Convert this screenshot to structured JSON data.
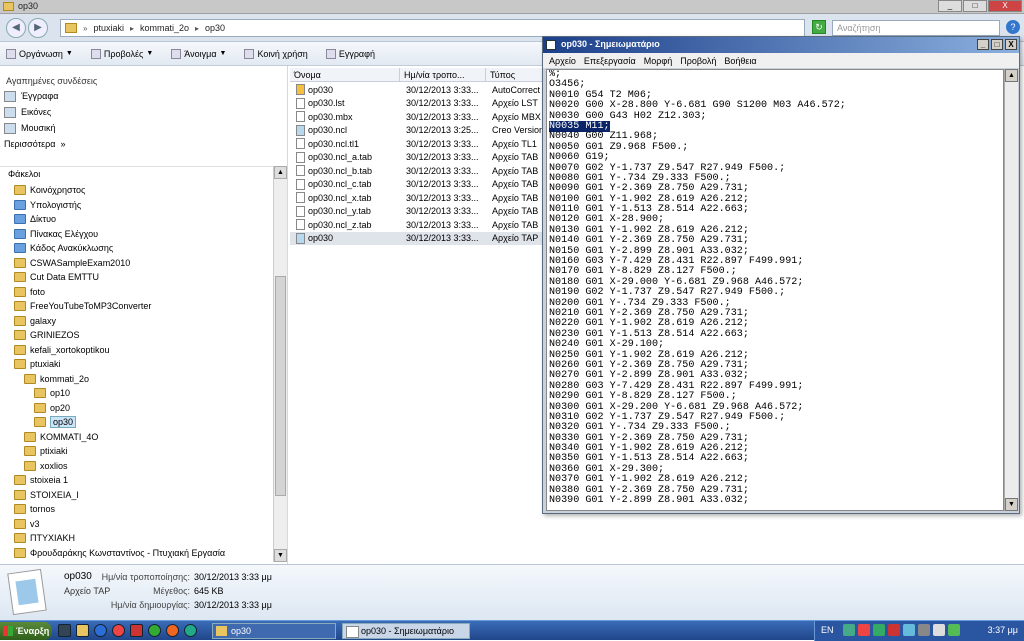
{
  "window": {
    "title": "op30",
    "min_label": "_",
    "max_label": "□",
    "close_label": "X"
  },
  "address": {
    "breadcrumbs": [
      "ptuxiaki",
      "kommati_2o",
      "op30"
    ],
    "search_placeholder": "Αναζήτηση"
  },
  "toolbar": {
    "items": [
      "Οργάνωση",
      "Προβολές",
      "Άνοιγμα",
      "Κοινή χρήση",
      "Εγγραφή"
    ]
  },
  "sidebar": {
    "favorites_header": "Αγαπημένες συνδέσεις",
    "favorites": [
      "Έγγραφα",
      "Εικόνες",
      "Μουσική",
      "Περισσότερα"
    ],
    "folders_header": "Φάκελοι",
    "folders": [
      {
        "label": "Κοινόχρηστος",
        "level": 1,
        "special": false
      },
      {
        "label": "Υπολογιστής",
        "level": 1,
        "special": true
      },
      {
        "label": "Δίκτυο",
        "level": 1,
        "special": true
      },
      {
        "label": "Πίνακας Ελέγχου",
        "level": 1,
        "special": true
      },
      {
        "label": "Κάδος Ανακύκλωσης",
        "level": 1,
        "special": true
      },
      {
        "label": "CSWASampleExam2010",
        "level": 1,
        "special": false
      },
      {
        "label": "Cut Data EMTTU",
        "level": 1,
        "special": false
      },
      {
        "label": "foto",
        "level": 1,
        "special": false
      },
      {
        "label": "FreeYouTubeToMP3Converter",
        "level": 1,
        "special": false
      },
      {
        "label": "galaxy",
        "level": 1,
        "special": false
      },
      {
        "label": "GRINIEZOS",
        "level": 1,
        "special": false
      },
      {
        "label": "kefali_xortokoptikou",
        "level": 1,
        "special": false
      },
      {
        "label": "ptuxiaki",
        "level": 1,
        "special": false
      },
      {
        "label": "kommati_2o",
        "level": 2,
        "special": false
      },
      {
        "label": "op10",
        "level": 3,
        "special": false
      },
      {
        "label": "op20",
        "level": 3,
        "special": false
      },
      {
        "label": "op30",
        "level": 3,
        "special": false,
        "selected": true
      },
      {
        "label": "KOMMATI_4O",
        "level": 2,
        "special": false
      },
      {
        "label": "ptixiaki",
        "level": 2,
        "special": false
      },
      {
        "label": "xoxlios",
        "level": 2,
        "special": false
      },
      {
        "label": "stoixeia 1",
        "level": 1,
        "special": false
      },
      {
        "label": "STOIXEIA_I",
        "level": 1,
        "special": false
      },
      {
        "label": "tornos",
        "level": 1,
        "special": false
      },
      {
        "label": "v3",
        "level": 1,
        "special": false
      },
      {
        "label": "ΠΤΥΧΙΑΚΗ",
        "level": 1,
        "special": false
      },
      {
        "label": "Φρουδαράκης Κωνσταντίνος - Πτυχιακή Εργασία",
        "level": 1,
        "special": false
      }
    ]
  },
  "filelist": {
    "headers": [
      "Όνομα",
      "Ημ/νία τροπο...",
      "Τύπος"
    ],
    "files": [
      {
        "name": "op030",
        "date": "30/12/2013 3:33...",
        "type": "AutoCorrect L",
        "icon": "ac"
      },
      {
        "name": "op030.lst",
        "date": "30/12/2013 3:33...",
        "type": "Αρχείο LST",
        "icon": "doc"
      },
      {
        "name": "op030.mbx",
        "date": "30/12/2013 3:33...",
        "type": "Αρχείο MBX",
        "icon": "doc"
      },
      {
        "name": "op030.ncl",
        "date": "30/12/2013 3:25...",
        "type": "Creo Versione",
        "icon": "cr"
      },
      {
        "name": "op030.ncl.tl1",
        "date": "30/12/2013 3:33...",
        "type": "Αρχείο TL1",
        "icon": "doc"
      },
      {
        "name": "op030.ncl_a.tab",
        "date": "30/12/2013 3:33...",
        "type": "Αρχείο TAB",
        "icon": "doc"
      },
      {
        "name": "op030.ncl_b.tab",
        "date": "30/12/2013 3:33...",
        "type": "Αρχείο TAB",
        "icon": "doc"
      },
      {
        "name": "op030.ncl_c.tab",
        "date": "30/12/2013 3:33...",
        "type": "Αρχείο TAB",
        "icon": "doc"
      },
      {
        "name": "op030.ncl_x.tab",
        "date": "30/12/2013 3:33...",
        "type": "Αρχείο TAB",
        "icon": "doc"
      },
      {
        "name": "op030.ncl_y.tab",
        "date": "30/12/2013 3:33...",
        "type": "Αρχείο TAB",
        "icon": "doc"
      },
      {
        "name": "op030.ncl_z.tab",
        "date": "30/12/2013 3:33...",
        "type": "Αρχείο TAB",
        "icon": "doc"
      },
      {
        "name": "op030",
        "date": "30/12/2013 3:33...",
        "type": "Αρχείο TAP",
        "icon": "cr",
        "selected": true
      }
    ]
  },
  "details": {
    "name": "op030",
    "type": "Αρχείο TAP",
    "modified_label": "Ημ/νία τροποποίησης:",
    "modified_value": "30/12/2013 3:33 μμ",
    "size_label": "Μέγεθος:",
    "size_value": "645 KB",
    "created_label": "Ημ/νία δημιουργίας:",
    "created_value": "30/12/2013 3:33 μμ"
  },
  "notepad": {
    "title": "op030 - Σημειωματάριο",
    "menu": [
      "Αρχείο",
      "Επεξεργασία",
      "Μορφή",
      "Προβολή",
      "Βοήθεια"
    ],
    "lines": [
      "%;",
      "O3456;",
      "N0010 G54 T2 M06;",
      "N0020 G00 X-28.800 Y-6.681 G90 S1200 M03 A46.572;",
      "N0030 G00 G43 H02 Z12.303;",
      "N0035 M11;",
      "N0040 G00 Z11.968;",
      "N0050 G01 Z9.968 F500.;",
      "N0060 G19;",
      "N0070 G02 Y-1.737 Z9.547 R27.949 F500.;",
      "N0080 G01 Y-.734 Z9.333 F500.;",
      "N0090 G01 Y-2.369 Z8.750 A29.731;",
      "N0100 G01 Y-1.902 Z8.619 A26.212;",
      "N0110 G01 Y-1.513 Z8.514 A22.663;",
      "N0120 G01 X-28.900;",
      "N0130 G01 Y-1.902 Z8.619 A26.212;",
      "N0140 G01 Y-2.369 Z8.750 A29.731;",
      "N0150 G01 Y-2.899 Z8.901 A33.032;",
      "N0160 G03 Y-7.429 Z8.431 R22.897 F499.991;",
      "N0170 G01 Y-8.829 Z8.127 F500.;",
      "N0180 G01 X-29.000 Y-6.681 Z9.968 A46.572;",
      "N0190 G02 Y-1.737 Z9.547 R27.949 F500.;",
      "N0200 G01 Y-.734 Z9.333 F500.;",
      "N0210 G01 Y-2.369 Z8.750 A29.731;",
      "N0220 G01 Y-1.902 Z8.619 A26.212;",
      "N0230 G01 Y-1.513 Z8.514 A22.663;",
      "N0240 G01 X-29.100;",
      "N0250 G01 Y-1.902 Z8.619 A26.212;",
      "N0260 G01 Y-2.369 Z8.750 A29.731;",
      "N0270 G01 Y-2.899 Z8.901 A33.032;",
      "N0280 G03 Y-7.429 Z8.431 R22.897 F499.991;",
      "N0290 G01 Y-8.829 Z8.127 F500.;",
      "N0300 G01 X-29.200 Y-6.681 Z9.968 A46.572;",
      "N0310 G02 Y-1.737 Z9.547 R27.949 F500.;",
      "N0320 G01 Y-.734 Z9.333 F500.;",
      "N0330 G01 Y-2.369 Z8.750 A29.731;",
      "N0340 G01 Y-1.902 Z8.619 A26.212;",
      "N0350 G01 Y-1.513 Z8.514 A22.663;",
      "N0360 G01 X-29.300;",
      "N0370 G01 Y-1.902 Z8.619 A26.212;",
      "N0380 G01 Y-2.369 Z8.750 A29.731;",
      "N0390 G01 Y-2.899 Z8.901 A33.032;"
    ],
    "selected_line": "N0035 M11;"
  },
  "taskbar": {
    "start_label": "Έναρξη",
    "buttons": [
      "op30",
      "op030 - Σημειωματάριο"
    ],
    "language": "EN",
    "clock": "3:37 μμ"
  }
}
